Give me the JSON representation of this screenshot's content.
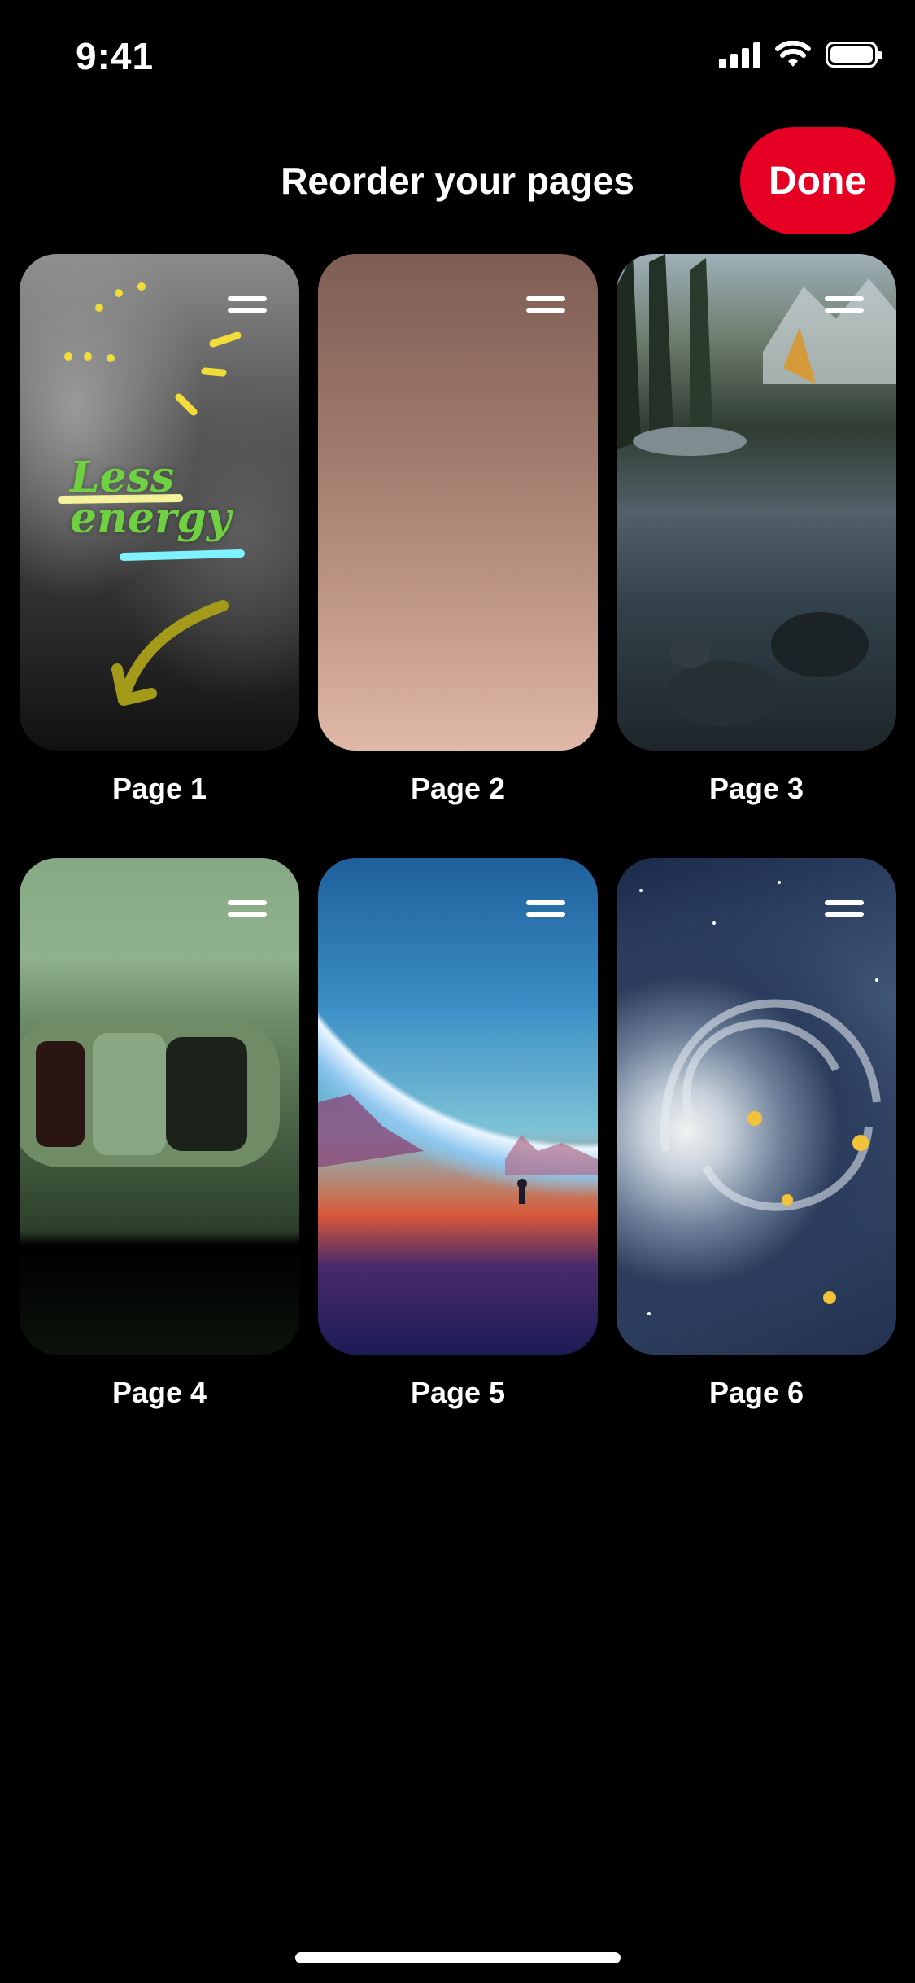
{
  "status_bar": {
    "time": "9:41"
  },
  "header": {
    "title": "Reorder your pages",
    "done_label": "Done"
  },
  "pages": [
    {
      "label": "Page 1",
      "sticker_text": "Less energy"
    },
    {
      "label": "Page 2"
    },
    {
      "label": "Page 3"
    },
    {
      "label": "Page 4"
    },
    {
      "label": "Page 5"
    },
    {
      "label": "Page 6"
    }
  ],
  "colors": {
    "accent": "#e60023",
    "background": "#000000",
    "text": "#ffffff"
  },
  "icons": {
    "drag_handle": "drag-handle-icon"
  }
}
